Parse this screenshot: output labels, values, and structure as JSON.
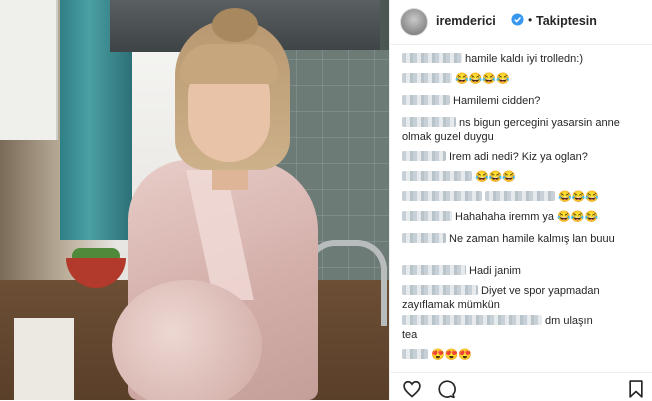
{
  "post": {
    "username": "iremderici",
    "separator": "•",
    "follow_label": "Takiptesin"
  },
  "icons": {
    "verified": "verified-badge-icon",
    "like": "heart-icon",
    "comment": "comment-icon",
    "save": "bookmark-icon"
  },
  "colors": {
    "verified": "#3897f0",
    "text": "#262626",
    "border": "#efefef"
  },
  "comments": [
    {
      "text": "hamile kaldı iyi trolledn:)",
      "emoji": ""
    },
    {
      "text": "",
      "emoji": "😂😂😂😂"
    },
    {
      "text": "Hamilemi cidden?",
      "emoji": ""
    },
    {
      "text": "ns bigun gercegini yasarsin anne",
      "text2": "olmak guzel duygu",
      "emoji": ""
    },
    {
      "text": "Irem adi nedi? Kiz ya oglan?",
      "emoji": ""
    },
    {
      "text": "",
      "emoji": "😂😂😂"
    },
    {
      "text": "",
      "emoji": "😂😂😂"
    },
    {
      "text": "Hahahaha iremm ya",
      "emoji": "😂😂😂"
    },
    {
      "text": "Ne zaman hamile kalmış lan buuu",
      "emoji": ""
    },
    {
      "text": "Hadi janim",
      "emoji": ""
    },
    {
      "text": "Diyet ve spor yapmadan",
      "text2": "zayıflamak mümkün",
      "emoji": ""
    },
    {
      "text": "dm ulaşın",
      "text2": "tea",
      "emoji": ""
    },
    {
      "text": "",
      "emoji": "😍😍😍"
    }
  ]
}
